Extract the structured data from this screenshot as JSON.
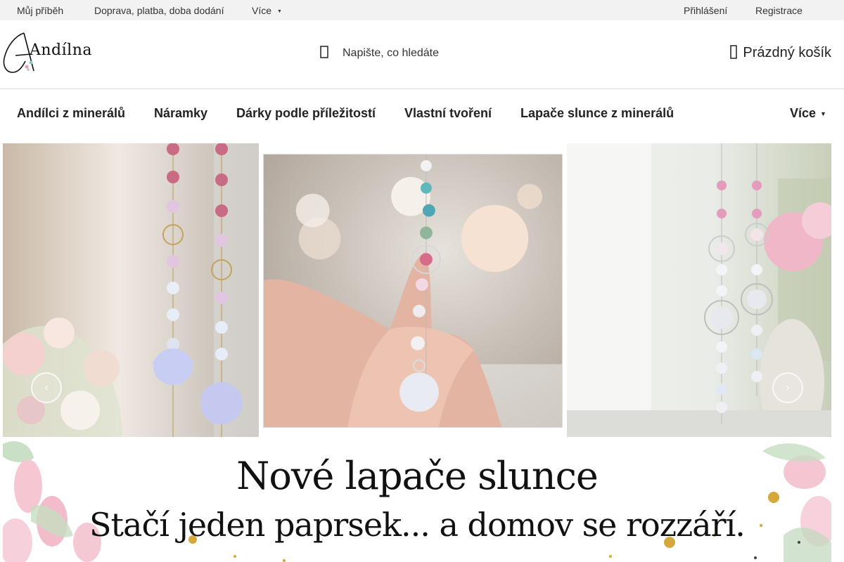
{
  "topbar": {
    "links": [
      "Můj příběh",
      "Doprava, platba, doba dodání",
      "Více"
    ],
    "account": [
      "Přihlášení",
      "Registrace"
    ]
  },
  "header": {
    "logo_text": "Andílna",
    "search_placeholder": "Napište, co hledáte",
    "cart_label": "Prázdný košík"
  },
  "nav": {
    "items": [
      "Andílci z minerálů",
      "Náramky",
      "Dárky podle příležitostí",
      "Vlastní tvoření",
      "Lapače slunce z minerálů",
      "Více"
    ]
  },
  "gallery": {
    "prev_icon": "chevron-left-icon",
    "next_icon": "chevron-right-icon"
  },
  "banner": {
    "title": "Nové lapače slunce",
    "subtitle": "Stačí jeden paprsek... a domov se rozzáří."
  },
  "colors": {
    "topbar_bg": "#f2f2f2",
    "accent_gold": "#c9a227",
    "tulip_pink": "#f2c4cf"
  }
}
